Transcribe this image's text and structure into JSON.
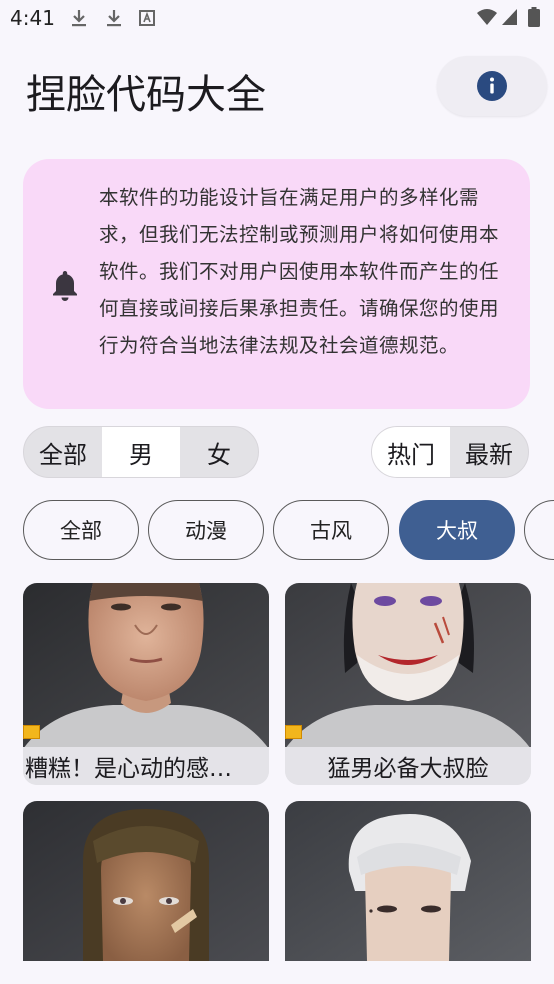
{
  "status": {
    "time": "4:41"
  },
  "header": {
    "title": "捏脸代码大全"
  },
  "notice": {
    "text": "本软件的功能设计旨在满足用户的多样化需求，但我们无法控制或预测用户将如何使用本软件。我们不对用户因使用本软件而产生的任何直接或间接后果承担责任。请确保您的使用行为符合当地法律法规及社会道德规范。"
  },
  "gender_filter": {
    "items": [
      "全部",
      "男",
      "女"
    ],
    "selected": "男"
  },
  "sort_filter": {
    "items": [
      "热门",
      "最新"
    ],
    "selected": "热门"
  },
  "categories": {
    "items": [
      "全部",
      "动漫",
      "古风",
      "大叔"
    ],
    "selected": "大叔"
  },
  "cards": [
    {
      "caption": "糟糕！是心动的感…"
    },
    {
      "caption": "猛男必备大叔脸"
    },
    {
      "caption": ""
    },
    {
      "caption": ""
    }
  ],
  "colors": {
    "accent": "#3f5f92",
    "notice_bg": "#f9d9f8",
    "icon": "#2a4a80"
  }
}
